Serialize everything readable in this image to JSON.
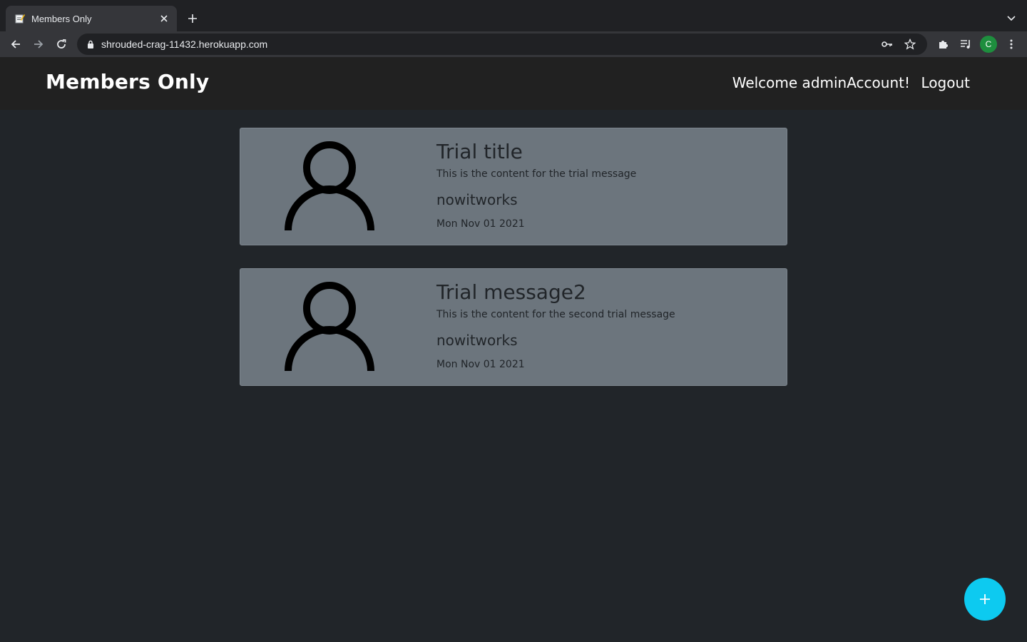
{
  "browser": {
    "tab_title": "Members Only",
    "url": "shrouded-crag-11432.herokuapp.com",
    "profile_initial": "C",
    "profile_color": "#1e8e3e"
  },
  "navbar": {
    "brand": "Members Only",
    "welcome": "Welcome adminAccount!",
    "logout": "Logout"
  },
  "messages": [
    {
      "title": "Trial title",
      "text": "This is the content for the trial message",
      "author": "nowitworks",
      "date": "Mon Nov 01 2021"
    },
    {
      "title": "Trial message2",
      "text": "This is the content for the second trial message",
      "author": "nowitworks",
      "date": "Mon Nov 01 2021"
    }
  ],
  "fab": {
    "icon": "plus-icon",
    "color": "#0dcaf0"
  },
  "colors": {
    "page_bg": "#212529",
    "navbar_bg": "#212121",
    "card_bg": "#6c757d"
  }
}
